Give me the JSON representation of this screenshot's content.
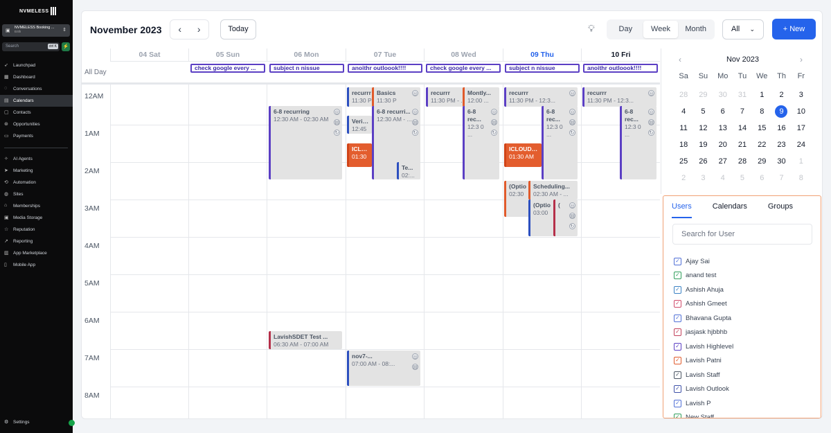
{
  "sidebar": {
    "logo": "NVMELESS",
    "account": {
      "name": "NVMELESS Booking ...",
      "sub": "Erith"
    },
    "search": {
      "placeholder": "Search",
      "shortcut": "ctrl K"
    },
    "items": [
      {
        "label": "Launchpad",
        "icon": "rocket-icon"
      },
      {
        "label": "Dashboard",
        "icon": "dashboard-icon"
      },
      {
        "label": "Conversations",
        "icon": "chat-icon"
      },
      {
        "label": "Calendars",
        "icon": "calendar-icon",
        "active": true
      },
      {
        "label": "Contacts",
        "icon": "contacts-icon"
      },
      {
        "label": "Opportunities",
        "icon": "opportunities-icon"
      },
      {
        "label": "Payments",
        "icon": "payments-icon"
      }
    ],
    "items2": [
      {
        "label": "AI Agents",
        "icon": "ai-icon"
      },
      {
        "label": "Marketing",
        "icon": "marketing-icon"
      },
      {
        "label": "Automation",
        "icon": "automation-icon"
      },
      {
        "label": "Sites",
        "icon": "globe-icon"
      },
      {
        "label": "Memberships",
        "icon": "membership-icon"
      },
      {
        "label": "Media Storage",
        "icon": "media-icon"
      },
      {
        "label": "Reputation",
        "icon": "star-icon"
      },
      {
        "label": "Reporting",
        "icon": "chart-icon"
      },
      {
        "label": "App Marketplace",
        "icon": "marketplace-icon"
      },
      {
        "label": "Mobile App",
        "icon": "mobile-icon"
      }
    ],
    "settings": "Settings"
  },
  "toolbar": {
    "title": "November 2023",
    "prev": "‹",
    "next": "›",
    "today": "Today",
    "views": [
      "Day",
      "Week",
      "Month"
    ],
    "active_view": "Week",
    "filter": "All",
    "new": "+ New"
  },
  "calendar": {
    "days": [
      "04 Sat",
      "05 Sun",
      "06 Mon",
      "07 Tue",
      "08 Wed",
      "09 Thu",
      "10 Fri"
    ],
    "allday_label": "All Day",
    "allday_events": [
      "check google every ...",
      "subject n nissue",
      "anoithr outloook!!!!",
      "check google every ...",
      "subject n nissue",
      "anoithr outloook!!!!"
    ],
    "hours": [
      "12AM",
      "1AM",
      "2AM",
      "3AM",
      "4AM",
      "5AM",
      "6AM",
      "7AM",
      "8AM"
    ],
    "events": {
      "mon_recurring": {
        "title": "6-8 recurring",
        "time": "12:30 AM - 02:30 AM"
      },
      "mon_lavish": {
        "title": "LavishSDET Test ...",
        "time": "06:30 AM - 07:00 AM"
      },
      "tue_recurr": {
        "title": "recurrr",
        "time": "11:30 P"
      },
      "tue_basics": {
        "title": "Basics",
        "time": "11:30 P"
      },
      "tue_recurri": {
        "title": "6-8 recurri...",
        "time": "12:30 AM - ..."
      },
      "tue_verifa": {
        "title": "Verifaj",
        "time": "12:45"
      },
      "tue_icloud": {
        "title": "ICLOUD",
        "time": "01:30"
      },
      "tue_te": {
        "title": "Te...",
        "time": "02:..."
      },
      "tue_nov7": {
        "title": "nov7-...",
        "time": "07:00 AM - 08:..."
      },
      "wed_recurr": {
        "title": "recurrr",
        "time": "11:30 PM - ..."
      },
      "wed_montly": {
        "title": "Montly...",
        "time": "12:00 ..."
      },
      "wed_rec": {
        "title": "6-8 rec...",
        "time": "12:3 0 ..."
      },
      "thu_recurr": {
        "title": "recurrr",
        "time": "11:30 PM - 12:3..."
      },
      "thu_rec": {
        "title": "6-8 rec...",
        "time": "12:3 0 ..."
      },
      "thu_icloud": {
        "title": "ICLOUD Re",
        "time": "01:30 AM"
      },
      "thu_optio1": {
        "title": "(Optio",
        "time": "02:30"
      },
      "thu_sched": {
        "title": "Scheduling...",
        "time": "02:30 AM - ..."
      },
      "thu_optio2": {
        "title": "(Optio",
        "time": "03:00"
      },
      "thu_paren": {
        "title": "(",
        "time": ""
      },
      "fri_recurr": {
        "title": "recurrr",
        "time": "11:30 PM - 12:3..."
      },
      "fri_rec": {
        "title": "6-8 rec...",
        "time": "12:3 0 ..."
      }
    }
  },
  "mini_calendar": {
    "title": "Nov 2023",
    "weekdays": [
      "Sa",
      "Su",
      "Mo",
      "Tu",
      "We",
      "Th",
      "Fr"
    ],
    "weeks": [
      [
        "28",
        "29",
        "30",
        "31",
        "1",
        "2",
        "3"
      ],
      [
        "4",
        "5",
        "6",
        "7",
        "8",
        "9",
        "10"
      ],
      [
        "11",
        "12",
        "13",
        "14",
        "15",
        "16",
        "17"
      ],
      [
        "18",
        "19",
        "20",
        "21",
        "22",
        "23",
        "24"
      ],
      [
        "25",
        "26",
        "27",
        "28",
        "29",
        "30",
        "1"
      ],
      [
        "2",
        "3",
        "4",
        "5",
        "6",
        "7",
        "8"
      ]
    ],
    "selected": "9"
  },
  "users_panel": {
    "tabs": [
      "Users",
      "Calendars",
      "Groups"
    ],
    "search_placeholder": "Search for User",
    "users": [
      {
        "name": "Ajay Sai",
        "color": "#4f6fd6"
      },
      {
        "name": "anand test",
        "color": "#2f9e5b"
      },
      {
        "name": "Ashish Ahuja",
        "color": "#3b82c4"
      },
      {
        "name": "Ashish Gmeet",
        "color": "#d04a6a"
      },
      {
        "name": "Bhavana Gupta",
        "color": "#4f6fd6"
      },
      {
        "name": "jasjask hjbbhb",
        "color": "#c2415b"
      },
      {
        "name": "Lavish Highlevel",
        "color": "#5b3fc4"
      },
      {
        "name": "Lavish Patni",
        "color": "#e05a2b"
      },
      {
        "name": "Lavish Staff",
        "color": "#4b5563"
      },
      {
        "name": "Lavish Outlook",
        "color": "#3f51a8"
      },
      {
        "name": "Lavish P",
        "color": "#4f6fd6"
      },
      {
        "name": "New Staff",
        "color": "#2f9e5b"
      }
    ]
  }
}
